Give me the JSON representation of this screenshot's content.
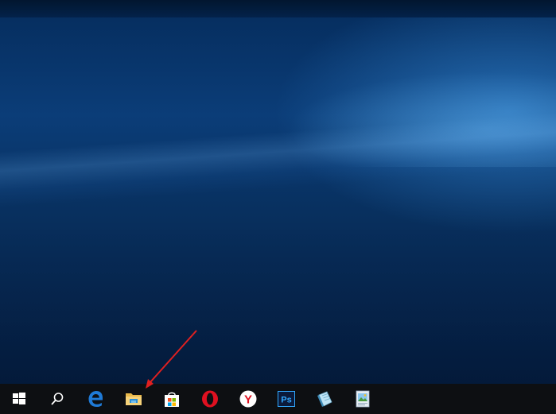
{
  "taskbar": {
    "items": [
      {
        "id": "start",
        "icon": "windows-logo-icon"
      },
      {
        "id": "search",
        "icon": "search-icon"
      },
      {
        "id": "edge",
        "icon": "edge-icon"
      },
      {
        "id": "file-explorer",
        "icon": "folder-icon"
      },
      {
        "id": "store",
        "icon": "store-icon"
      },
      {
        "id": "opera",
        "icon": "opera-icon"
      },
      {
        "id": "yandex",
        "icon": "yandex-browser-icon",
        "text": "Y"
      },
      {
        "id": "photoshop",
        "icon": "photoshop-icon",
        "text": "Ps"
      },
      {
        "id": "notepad",
        "icon": "notepad-icon"
      },
      {
        "id": "image-viewer",
        "icon": "image-viewer-icon"
      }
    ]
  },
  "annotation": {
    "color": "#e02020",
    "target": "file-explorer"
  },
  "colors": {
    "taskbar": "#0d0f12",
    "edge": "#1f7ad6",
    "opera": "#e01020",
    "photoshop_bg": "#0b1a3a",
    "photoshop_text": "#31a8ff"
  }
}
